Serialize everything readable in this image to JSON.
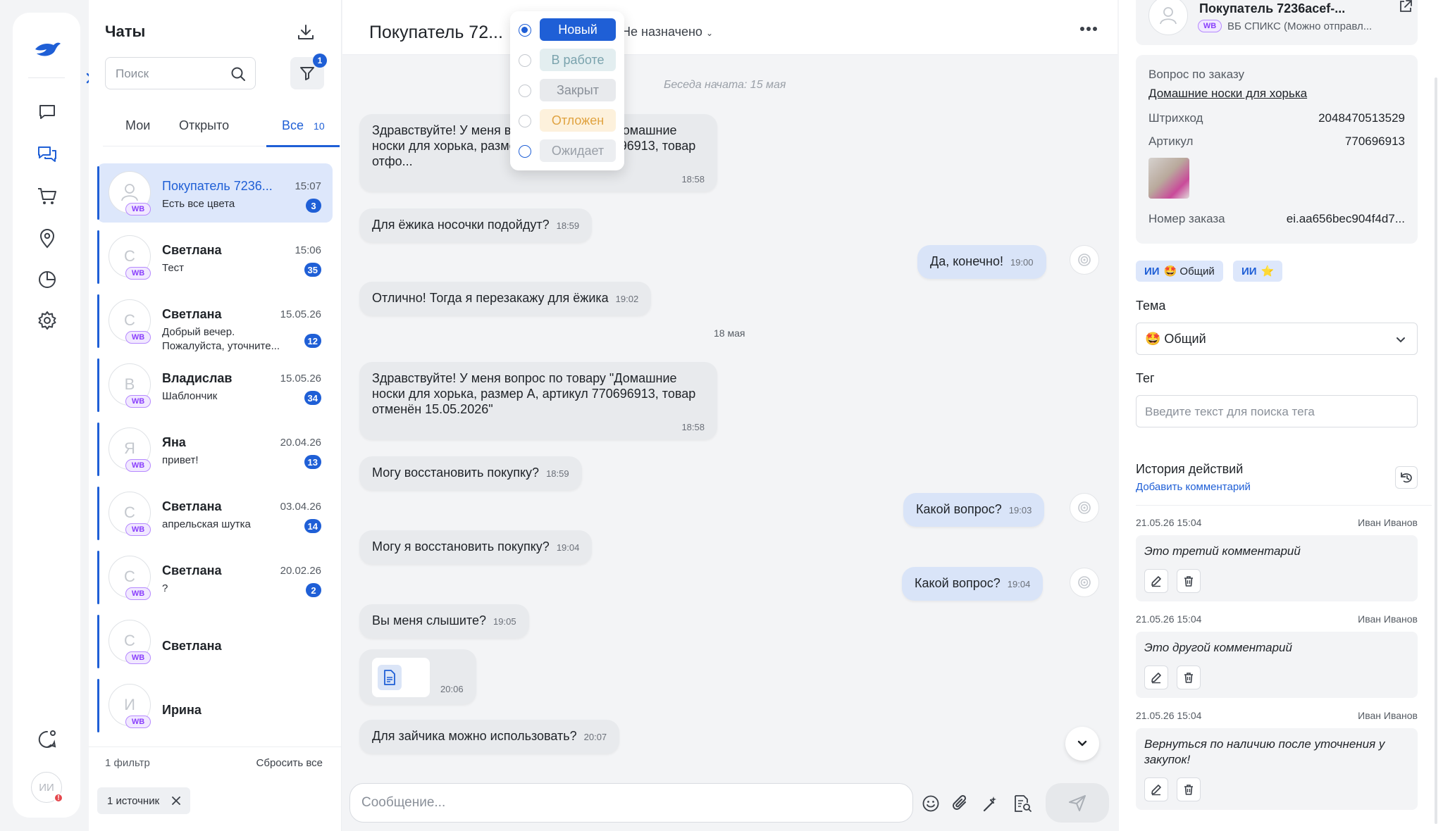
{
  "list": {
    "title": "Чаты",
    "search_placeholder": "Поиск",
    "filter_count": "1",
    "tabs": [
      {
        "label": "Мои"
      },
      {
        "label": "Открыто"
      },
      {
        "label": "Все",
        "count": "10"
      }
    ],
    "chats": [
      {
        "name": "Покупатель 7236...",
        "time": "15:07",
        "message": "Есть все цвета",
        "unread": "3",
        "initial": "",
        "source": "WB",
        "selected": true
      },
      {
        "name": "Светлана",
        "time": "15:06",
        "message": "Тест",
        "unread": "35",
        "initial": "С",
        "source": "WB"
      },
      {
        "name": "Светлана",
        "time": "15.05.26",
        "message": "Добрый вечер. Пожалуйста, уточните...",
        "unread": "12",
        "initial": "С",
        "source": "WB"
      },
      {
        "name": "Владислав",
        "time": "15.05.26",
        "message": "Шаблончик",
        "unread": "34",
        "initial": "В",
        "source": "WB"
      },
      {
        "name": "Яна",
        "time": "20.04.26",
        "message": "привет!",
        "unread": "13",
        "initial": "Я",
        "source": "WB"
      },
      {
        "name": "Светлана",
        "time": "03.04.26",
        "message": "апрельская шутка",
        "unread": "14",
        "initial": "С",
        "source": "WB"
      },
      {
        "name": "Светлана",
        "time": "20.02.26",
        "message": "?",
        "unread": "2",
        "initial": "С",
        "source": "WB"
      },
      {
        "name": "Светлана",
        "time": "",
        "message": "",
        "unread": "",
        "initial": "С",
        "source": "WB"
      },
      {
        "name": "Ирина",
        "time": "",
        "message": "",
        "unread": "",
        "initial": "И",
        "source": "WB"
      }
    ],
    "footer_filters": "1 фильтр",
    "footer_reset": "Сбросить все",
    "source_chip": "1 источник"
  },
  "conversation": {
    "title": "Покупатель 72...",
    "assignee": "Не назначено",
    "started": "Беседа начата: 15 мая",
    "date_separator": "18 мая",
    "messages": [
      {
        "text": "Здравствуйте! У меня вопрос по товару \"Домашние носки для хорька, размер А, артикул 770696913, товар отфо...",
        "time": "18:58",
        "dir": "in"
      },
      {
        "text": "Для ёжика носочки подойдут?",
        "time": "18:59",
        "dir": "in"
      },
      {
        "text": "Да, конечно!",
        "time": "19:00",
        "dir": "out"
      },
      {
        "text": "Отлично! Тогда я перезакажу для ёжика",
        "time": "19:02",
        "dir": "in"
      },
      {
        "text": "Здравствуйте! У меня вопрос по товару \"Домашние носки для хорька, размер А, артикул 770696913, товар отменён 15.05.2026\"",
        "time": "18:58",
        "dir": "in"
      },
      {
        "text": "Могу восстановить покупку?",
        "time": "18:59",
        "dir": "in"
      },
      {
        "text": "Какой вопрос?",
        "time": "19:03",
        "dir": "out"
      },
      {
        "text": "Могу я восстановить покупку?",
        "time": "19:04",
        "dir": "in"
      },
      {
        "text": "Какой вопрос?",
        "time": "19:04",
        "dir": "out"
      },
      {
        "text": "Вы меня слышите?",
        "time": "19:05",
        "dir": "in"
      },
      {
        "text": "",
        "time": "20:06",
        "dir": "in",
        "attachment": "file"
      },
      {
        "text": "Для зайчика можно использовать?",
        "time": "20:07",
        "dir": "in"
      }
    ],
    "composer_placeholder": "Сообщение..."
  },
  "status_menu": {
    "options": [
      {
        "label": "Новый",
        "selected": true,
        "bg": "#1f5fd6",
        "fg": "#ffffff"
      },
      {
        "label": "В работе",
        "selected": false,
        "bg": "#e3eef0",
        "fg": "#7aa3ad"
      },
      {
        "label": "Закрыт",
        "selected": false,
        "bg": "#e8eaed",
        "fg": "#8a9099"
      },
      {
        "label": "Отложен",
        "selected": false,
        "bg": "#fdf1dc",
        "fg": "#e0a341"
      },
      {
        "label": "Ожидает",
        "selected": false,
        "bg": "#eceef1",
        "fg": "#9aa0a8"
      }
    ]
  },
  "panel": {
    "customer": {
      "name": "Покупатель 7236acef-...",
      "source_badge": "WB",
      "source": "ВБ СПИКС (Можно отправл..."
    },
    "order": {
      "question_label": "Вопрос по заказу",
      "product": "Домашние носки для хорька",
      "barcode_label": "Штрихкод",
      "barcode": "2048470513529",
      "article_label": "Артикул",
      "article": "770696913",
      "order_label": "Номер заказа",
      "order_number": "ei.aa656bec904f4d7..."
    },
    "ai_chips": [
      {
        "prefix": "ИИ",
        "text": "🤩 Общий"
      },
      {
        "prefix": "ИИ",
        "text": "⭐"
      }
    ],
    "topic_title": "Тема",
    "topic_value": "🤩 Общий",
    "tag_title": "Тег",
    "tag_placeholder": "Введите текст для поиска тега",
    "history_title": "История действий",
    "history_add": "Добавить комментарий",
    "comments": [
      {
        "date": "21.05.26 15:04",
        "user": "Иван Иванов",
        "text": "Это третий комментарий"
      },
      {
        "date": "21.05.26 15:04",
        "user": "Иван Иванов",
        "text": "Это другой комментарий"
      },
      {
        "date": "21.05.26 15:04",
        "user": "Иван Иванов",
        "text": "Вернуться по наличию после уточнения у закупок!"
      }
    ]
  },
  "rail": {
    "avatar_initials": "ИИ",
    "alert": "!"
  },
  "colors": {
    "accent": "#1f5fd6",
    "wb": "#8a3ffc",
    "bubble_in": "#e8eaed",
    "bubble_out": "#d9e4f8"
  }
}
